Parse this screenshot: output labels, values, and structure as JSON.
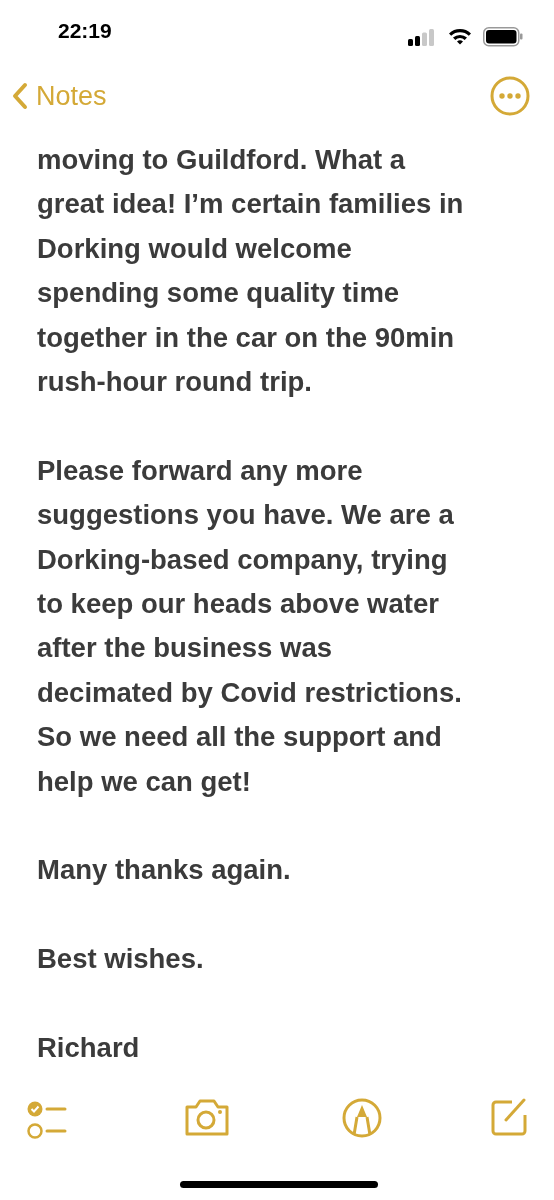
{
  "status_bar": {
    "time": "22:19"
  },
  "nav": {
    "back_label": "Notes"
  },
  "note": {
    "paragraphs": [
      {
        "lines": [
          "moving to Guildford. What a",
          "great idea! I’m certain families in",
          "Dorking would welcome",
          "spending some quality time",
          "together in the car on the 90min",
          "rush-hour round trip."
        ]
      },
      {
        "lines": [
          "Please forward any more",
          "suggestions you have. We are a",
          "Dorking-based company, trying",
          "to keep our heads above water",
          "after the business was",
          "decimated by Covid restrictions.",
          "So we need all the support and",
          "help we can get!"
        ]
      },
      {
        "lines": [
          "Many thanks again."
        ]
      },
      {
        "lines": [
          "Best wishes."
        ]
      },
      {
        "lines": [
          "Richard"
        ]
      }
    ]
  }
}
